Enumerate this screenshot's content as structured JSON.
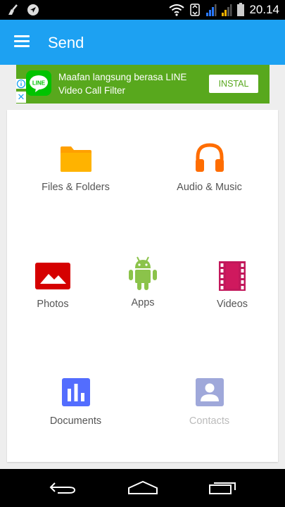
{
  "status_bar": {
    "time": "20.14",
    "icons": [
      "broom-icon",
      "navigation-icon",
      "wifi-icon",
      "data-icon",
      "signal-1-icon",
      "signal-2-icon",
      "battery-icon"
    ]
  },
  "appbar": {
    "title": "Send",
    "menu_icon": "hamburger-menu-icon"
  },
  "ad": {
    "text": "Maafan langsung berasa LINE Video Call Filter",
    "logo_text": "LINE",
    "button_label": "INSTAL",
    "close_glyph": "✕",
    "bg_color": "#58a81d"
  },
  "categories": {
    "files": {
      "label": "Files & Folders",
      "icon": "folder-icon",
      "color": "#ffa000"
    },
    "audio": {
      "label": "Audio & Music",
      "icon": "headphones-icon",
      "color": "#ff6d00"
    },
    "photos": {
      "label": "Photos",
      "icon": "photo-icon",
      "color": "#d50000"
    },
    "apps": {
      "label": "Apps",
      "icon": "android-icon",
      "color": "#8bc34a"
    },
    "videos": {
      "label": "Videos",
      "icon": "film-icon",
      "color": "#c2185b"
    },
    "documents": {
      "label": "Documents",
      "icon": "bar-chart-icon",
      "color": "#536dfe"
    },
    "contacts": {
      "label": "Contacts",
      "icon": "contact-card-icon",
      "color": "#7986cb",
      "disabled": true
    }
  },
  "nav_bar": {
    "icons": [
      "back-icon",
      "home-icon",
      "recent-apps-icon"
    ]
  }
}
